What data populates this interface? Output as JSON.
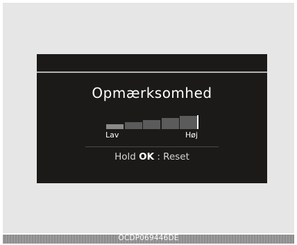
{
  "screen": {
    "title": "Opmærksomhed",
    "level": {
      "segments": 5,
      "selected": 1
    },
    "scale_low_label": "Lav",
    "scale_high_label": "Høj",
    "hint": {
      "prefix": "Hold",
      "key": "OK",
      "suffix": ": Reset"
    }
  },
  "figure_code": "OCDP069446DE",
  "colors": {
    "screen_bg": "#1b1a18",
    "text": "#ffffff",
    "inactive_segment": "#5b5b5b",
    "active_segment": "#8a8a8a"
  }
}
